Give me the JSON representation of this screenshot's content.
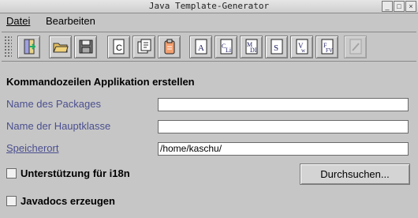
{
  "window": {
    "title": "Java Template-Generator",
    "title_buttons": [
      "_",
      "□",
      "×"
    ]
  },
  "menu": [
    {
      "label": "Datei"
    },
    {
      "label": "Bearbeiten"
    }
  ],
  "toolbar": {
    "buttons": [
      {
        "icon": "exit-door-icon"
      },
      {
        "icon": "open-folder-icon"
      },
      {
        "icon": "save-disk-icon"
      },
      {
        "icon": "new-class-icon"
      },
      {
        "icon": "new-application-icon"
      },
      {
        "icon": "new-applet-icon"
      },
      {
        "icon": "template-a-icon"
      },
      {
        "icon": "template-cli-icon"
      },
      {
        "icon": "template-mdi-icon"
      },
      {
        "icon": "template-s-icon"
      },
      {
        "icon": "template-v-icon"
      },
      {
        "icon": "template-fv-icon"
      },
      {
        "icon": "disabled-action-icon"
      }
    ]
  },
  "form": {
    "section_title": "Kommandozeilen Applikation erstellen",
    "fields": [
      {
        "label": "Name des Packages",
        "value": ""
      },
      {
        "label": "Name der Hauptklasse",
        "value": ""
      },
      {
        "label": "Speicherort",
        "value": "/home/kaschu/"
      }
    ],
    "i18n_checkbox": {
      "label": "Unterstützung für i18n",
      "checked": false
    },
    "javadoc_checkbox": {
      "label": "Javadocs erzeugen",
      "checked": false
    },
    "browse_button": {
      "label": "Durchsuchen..."
    }
  }
}
